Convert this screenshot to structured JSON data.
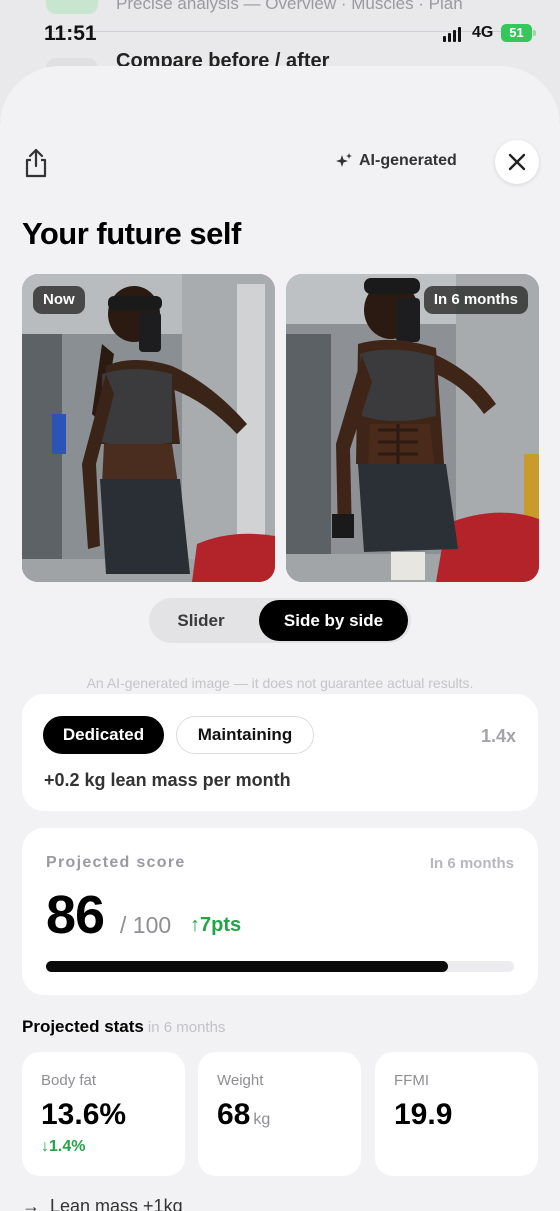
{
  "background_app": {
    "line1": "Precise analysis — Overview · Muscles · Plan",
    "line2": "Compare before / after"
  },
  "status_bar": {
    "time": "11:51",
    "network": "4G",
    "battery": "51"
  },
  "header": {
    "ai_badge": "AI-generated",
    "title": "Your future self"
  },
  "photos": {
    "now_label": "Now",
    "future_label": "In 6 months"
  },
  "view_toggle": {
    "options": [
      "Slider",
      "Side by side"
    ],
    "selected": "Side by side"
  },
  "disclaimer": "An AI-generated image — it does not guarantee actual results.",
  "plan": {
    "options": [
      "Dedicated",
      "Maintaining"
    ],
    "selected": "Dedicated",
    "multiplier": "1.4x",
    "description": "+0.2 kg lean mass per month"
  },
  "score": {
    "label": "Projected score",
    "when": "In 6 months",
    "value": "86",
    "max": "/ 100",
    "delta": "7pts",
    "progress_fraction": 0.86
  },
  "stats": {
    "title": "Projected stats",
    "subtitle": "in 6 months",
    "items": [
      {
        "label": "Body fat",
        "value": "13.6%",
        "unit": "",
        "delta": "1.4%"
      },
      {
        "label": "Weight",
        "value": "68",
        "unit": "kg",
        "delta": ""
      },
      {
        "label": "FFMI",
        "value": "19.9",
        "unit": "",
        "delta": ""
      }
    ]
  },
  "footer": {
    "lean_mass": "Lean mass +1kg"
  },
  "colors": {
    "accent_green": "#22a447",
    "selected_black": "#000000",
    "sheet_bg": "#f2f2f4"
  }
}
